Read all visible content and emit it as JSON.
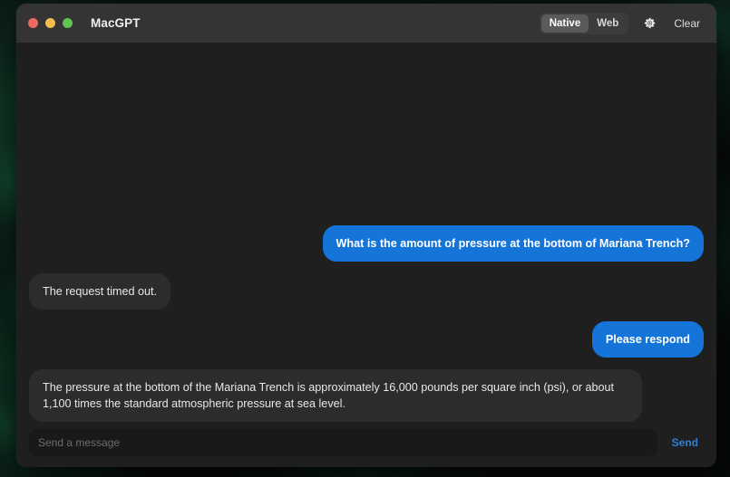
{
  "window": {
    "app_title": "MacGPT",
    "traffic_lights": [
      {
        "name": "close",
        "color": "#ec6a5e"
      },
      {
        "name": "minimize",
        "color": "#f4bd4f"
      },
      {
        "name": "zoom",
        "color": "#61c454"
      }
    ]
  },
  "toolbar": {
    "mode_options": [
      {
        "label": "Native",
        "selected": true
      },
      {
        "label": "Web",
        "selected": false
      }
    ],
    "settings_icon": "gear-icon",
    "clear_label": "Clear"
  },
  "conversation": {
    "messages": [
      {
        "role": "user",
        "text": "What is the amount of pressure at the bottom of Mariana Trench?"
      },
      {
        "role": "assistant",
        "text": "The request timed out."
      },
      {
        "role": "user",
        "text": "Please respond"
      },
      {
        "role": "assistant",
        "text": "The pressure at the bottom of the Mariana Trench is approximately 16,000 pounds per square inch (psi), or about 1,100 times the standard atmospheric pressure at sea level."
      }
    ]
  },
  "composer": {
    "input_value": "",
    "placeholder": "Send a message",
    "send_label": "Send"
  },
  "colors": {
    "accent_blue": "#1574d8",
    "send_blue": "#2f7fd4",
    "titlebar_bg": "#343434",
    "chat_bg": "#1f1f1f",
    "assistant_bubble": "#2c2c2c",
    "input_bg": "#191919"
  }
}
